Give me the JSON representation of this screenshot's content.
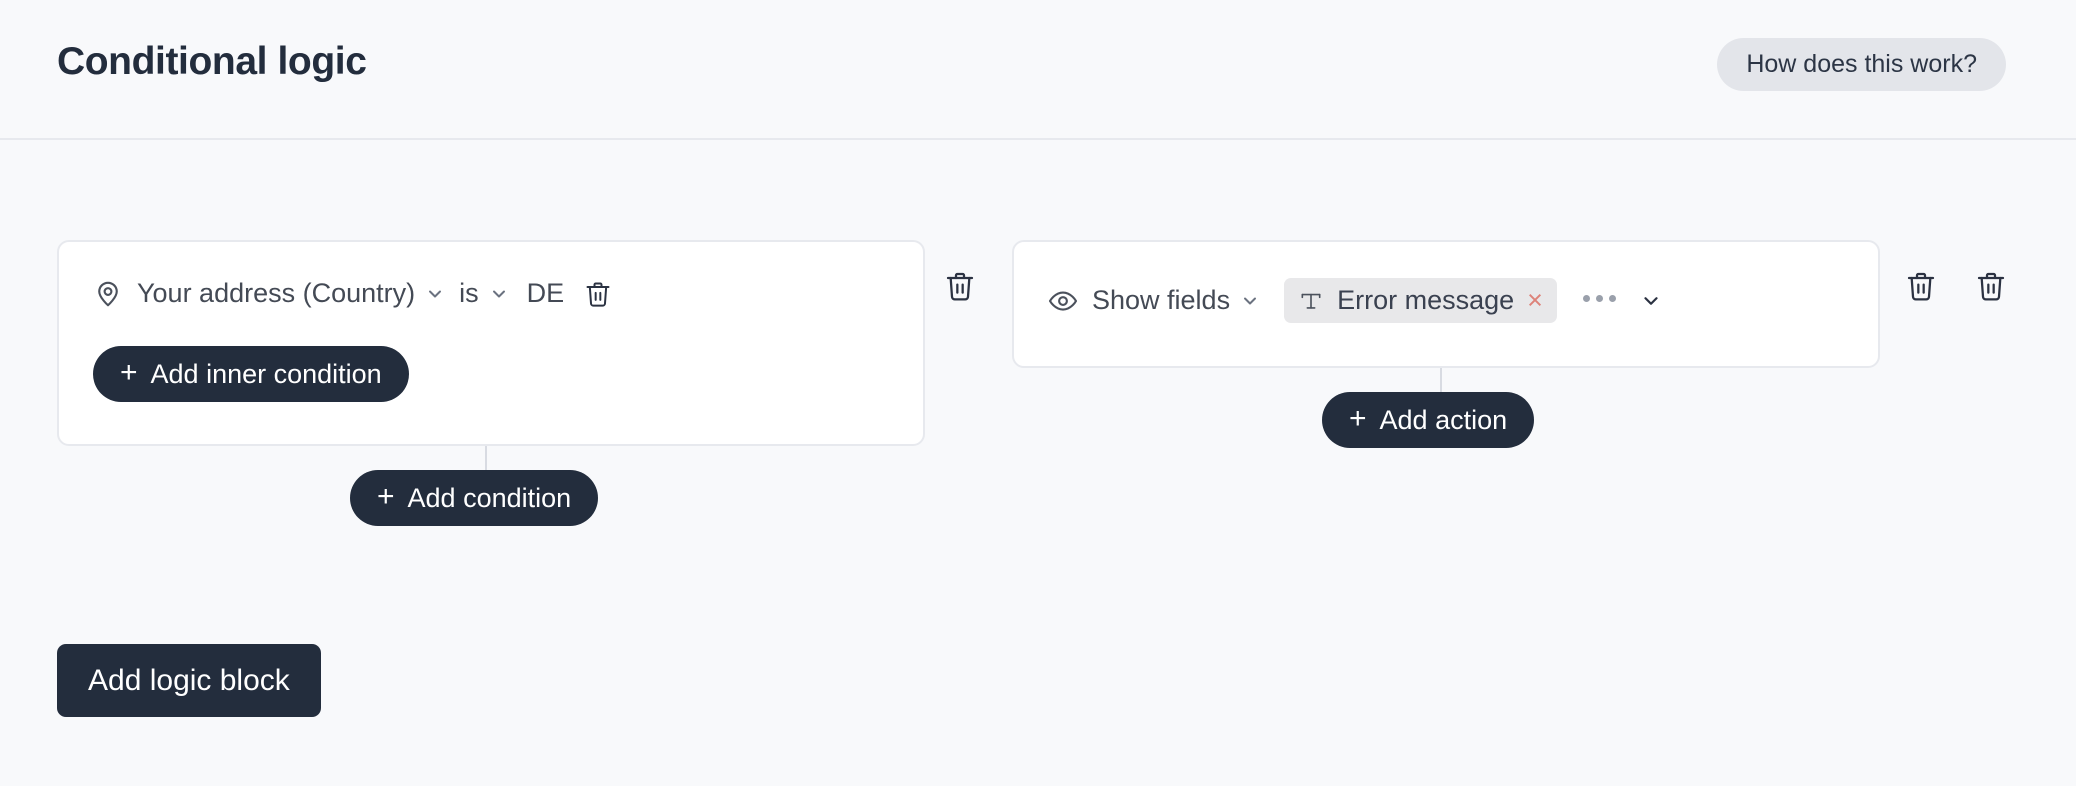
{
  "header": {
    "title": "Conditional logic",
    "help_label": "How does this work?"
  },
  "condition_block": {
    "condition": {
      "field_icon": "map-pin-icon",
      "field_label": "Your address (Country)",
      "operator_label": "is",
      "value_label": "DE",
      "delete_icon": "trash-icon"
    },
    "add_inner_condition_label": "Add inner condition",
    "add_condition_label": "Add condition",
    "delete_block_icon": "trash-icon",
    "plus_glyph": "+"
  },
  "action_block": {
    "action": {
      "type_icon": "eye-icon",
      "type_label": "Show fields",
      "target_chip": {
        "icon": "text-field-icon",
        "icon_glyph": "T",
        "label": "Error message",
        "remove_glyph": "×"
      },
      "overflow_label": "…"
    },
    "add_action_label": "Add action",
    "delete_action_icon": "trash-icon",
    "delete_block_icon": "trash-icon",
    "plus_glyph": "+"
  },
  "footer": {
    "add_logic_block_label": "Add logic block"
  },
  "colors": {
    "page_background": "#f8f9fb",
    "card_background": "#ffffff",
    "card_border": "#e7e9ee",
    "dark_button": "#232d3d",
    "help_pill": "#e3e5ea",
    "chip_background": "#e8e8ea",
    "chip_remove": "#dd8279",
    "connector_line": "#d8dbe2",
    "text_primary": "#232d3d",
    "text_secondary": "#444a55"
  }
}
